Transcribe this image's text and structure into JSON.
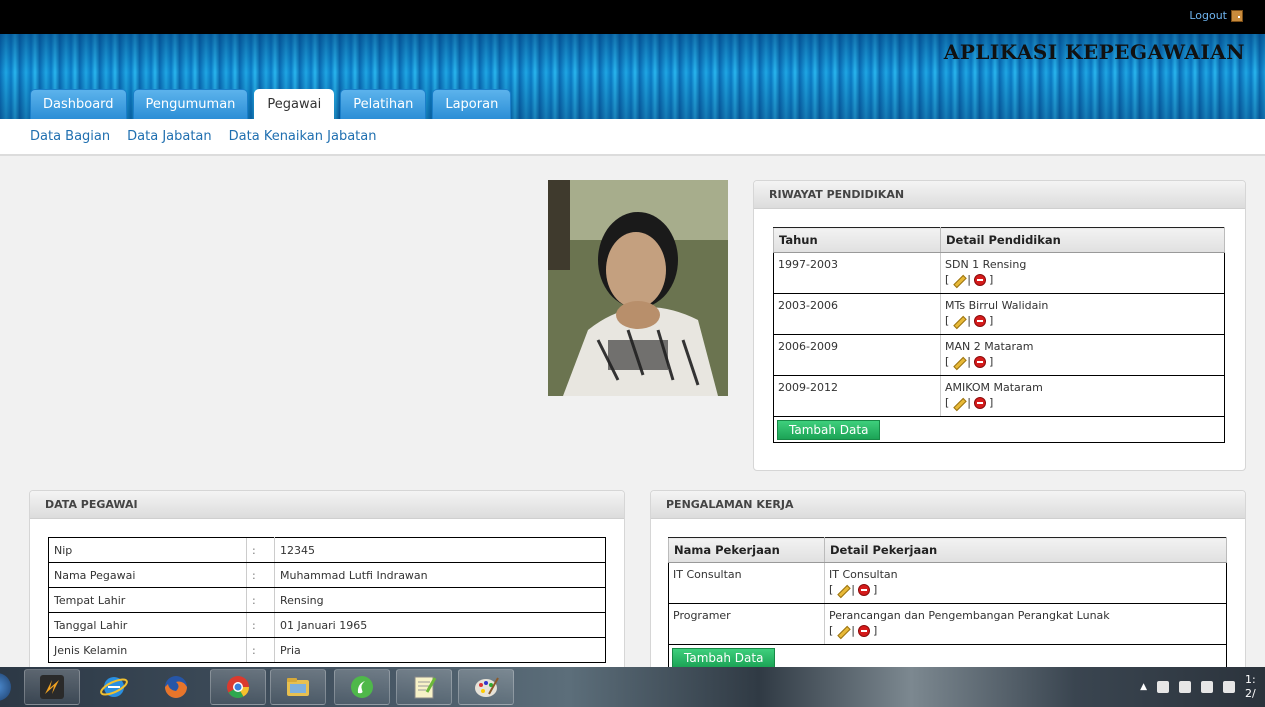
{
  "topbar": {
    "logout_label": "Logout"
  },
  "header": {
    "app_title": "APLIKASI KEPEGAWAIAN"
  },
  "tabs": [
    {
      "label": "Dashboard",
      "active": false
    },
    {
      "label": "Pengumuman",
      "active": false
    },
    {
      "label": "Pegawai",
      "active": true
    },
    {
      "label": "Pelatihan",
      "active": false
    },
    {
      "label": "Laporan",
      "active": false
    }
  ],
  "subnav": [
    "Data Bagian",
    "Data Jabatan",
    "Data Kenaikan Jabatan"
  ],
  "riwayat": {
    "title": "RIWAYAT PENDIDIKAN",
    "col_year": "Tahun",
    "col_detail": "Detail Pendidikan",
    "rows": [
      {
        "year": "1997-2003",
        "detail": "SDN 1 Rensing"
      },
      {
        "year": "2003-2006",
        "detail": "MTs Birrul Walidain"
      },
      {
        "year": "2006-2009",
        "detail": "MAN 2 Mataram"
      },
      {
        "year": "2009-2012",
        "detail": "AMIKOM Mataram"
      }
    ],
    "add_label": "Tambah Data"
  },
  "pegawai": {
    "title": "DATA PEGAWAI",
    "rows": [
      {
        "label": "Nip",
        "sep": ":",
        "value": "12345"
      },
      {
        "label": "Nama Pegawai",
        "sep": ":",
        "value": "Muhammad Lutfi Indrawan"
      },
      {
        "label": "Tempat Lahir",
        "sep": ":",
        "value": "Rensing"
      },
      {
        "label": "Tanggal Lahir",
        "sep": ":",
        "value": "01 Januari 1965"
      },
      {
        "label": "Jenis Kelamin",
        "sep": ":",
        "value": "Pria"
      }
    ]
  },
  "pengalaman": {
    "title": "PENGALAMAN KERJA",
    "col_job": "Nama Pekerjaan",
    "col_detail": "Detail Pekerjaan",
    "rows": [
      {
        "job": "IT Consultan",
        "detail": "IT Consultan"
      },
      {
        "job": "Programer",
        "detail": "Perancangan dan Pengembangan Perangkat Lunak"
      }
    ],
    "add_label": "Tambah Data"
  },
  "action_bracket_open": "[",
  "action_pipe": "|",
  "action_bracket_close": "]",
  "taskbar": {
    "apps": [
      "winamp-icon",
      "internet-explorer-icon",
      "firefox-icon",
      "chrome-icon",
      "file-explorer-icon",
      "dreamweaver-icon",
      "notepad-plus-plus-icon",
      "paint-icon"
    ],
    "clock_partial": [
      "1:",
      "2/"
    ]
  },
  "colors": {
    "header_blue": "#1fa7e4",
    "button_green": "#1ca356",
    "link_blue": "#1f6fb0"
  }
}
